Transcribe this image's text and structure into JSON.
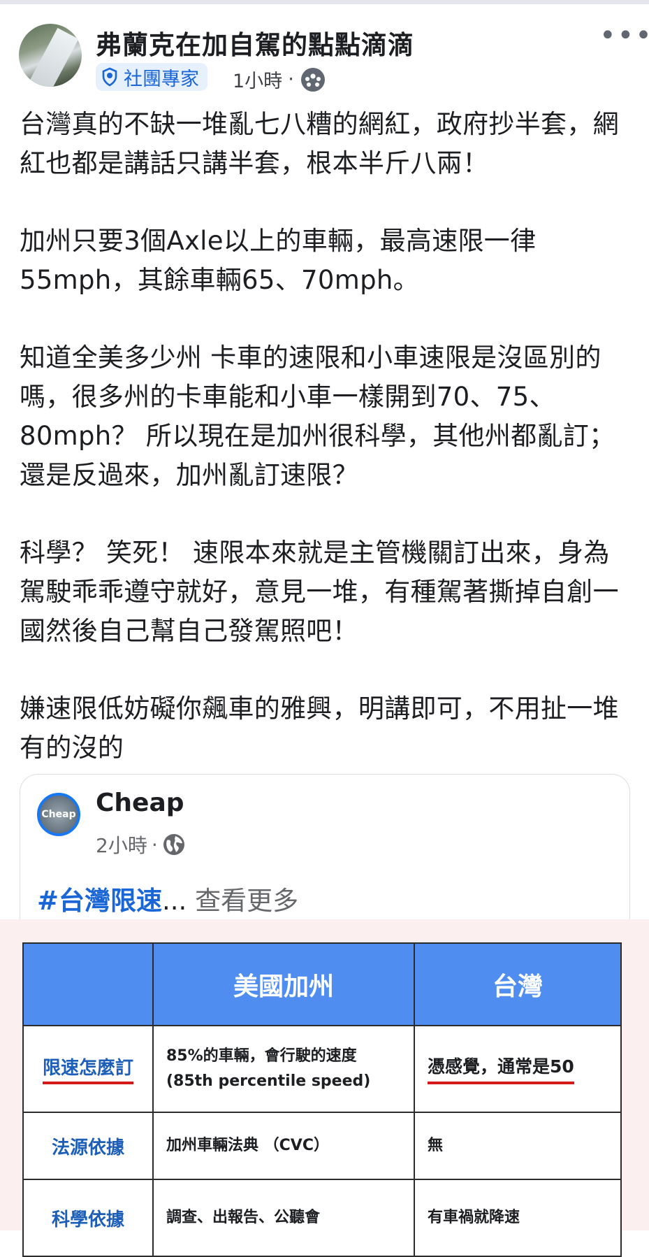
{
  "post": {
    "author": "弗蘭克在加自駕的點點滴滴",
    "badge": "社團專家",
    "time": "1小時",
    "separator": "·",
    "paragraphs": [
      "台灣真的不缺一堆亂七八糟的網紅，政府抄半套，網紅也都是講話只講半套，根本半斤八兩！",
      "加州只要3個Axle以上的車輛，最高速限一律55mph，其餘車輛65、70mph。",
      "知道全美多少州 卡車的速限和小車速限是沒區別的嗎，很多州的卡車能和小車一樣開到70、75、80mph？ 所以現在是加州很科學，其他州都亂訂；還是反過來，加州亂訂速限？",
      "科學？ 笑死！ 速限本來就是主管機關訂出來，身為駕駛乖乖遵守就好，意見一堆，有種駕著撕掉自創一國然後自己幫自己發駕照吧！",
      "嫌速限低妨礙你飆車的雅興，明講即可，不用扯一堆有的沒的"
    ]
  },
  "shared": {
    "avatar_text": "Cheap",
    "name": "Cheap",
    "time": "2小時",
    "separator": "·",
    "hashtag": "#台灣限速",
    "ellipsis": "...",
    "see_more": "查看更多"
  },
  "table": {
    "headers": [
      "",
      "美國加州",
      "台灣"
    ],
    "rows": [
      {
        "label": "限速怎麼訂",
        "ca": "85%的車輛，會行駛的速度\n(85th percentile speed)",
        "tw": "憑感覺，通常是50"
      },
      {
        "label": "法源依據",
        "ca": "加州車輛法典 （CVC）",
        "tw": "無"
      },
      {
        "label": "科學依據",
        "ca": "調查、出報告、公聽會",
        "tw": "有車禍就降速"
      }
    ]
  },
  "colors": {
    "link_blue": "#1a66d6",
    "header_blue": "#4f8ef0",
    "underline_red": "#d31919",
    "badge_bg": "#e7f0fd"
  },
  "icons": {
    "more": "more-dots-icon",
    "badge": "expert-badge-icon",
    "audience_group": "group-audience-icon",
    "audience_public": "globe-icon"
  }
}
